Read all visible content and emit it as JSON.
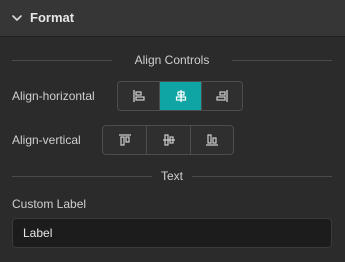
{
  "panel": {
    "title": "Format"
  },
  "align_controls": {
    "section_label": "Align Controls",
    "horizontal": {
      "label": "Align-horizontal",
      "selected": "center",
      "options": [
        "align-left-icon",
        "align-center-h-icon",
        "align-right-icon"
      ]
    },
    "vertical": {
      "label": "Align-vertical",
      "selected": null,
      "options": [
        "align-top-icon",
        "align-middle-v-icon",
        "align-bottom-icon"
      ]
    }
  },
  "text": {
    "section_label": "Text",
    "custom_label": {
      "label": "Custom Label",
      "value": "Label"
    }
  },
  "colors": {
    "accent": "#0ea5a4",
    "panel_bg": "#2b2b2b",
    "header_bg": "#363636",
    "input_bg": "#1c1c1c"
  }
}
